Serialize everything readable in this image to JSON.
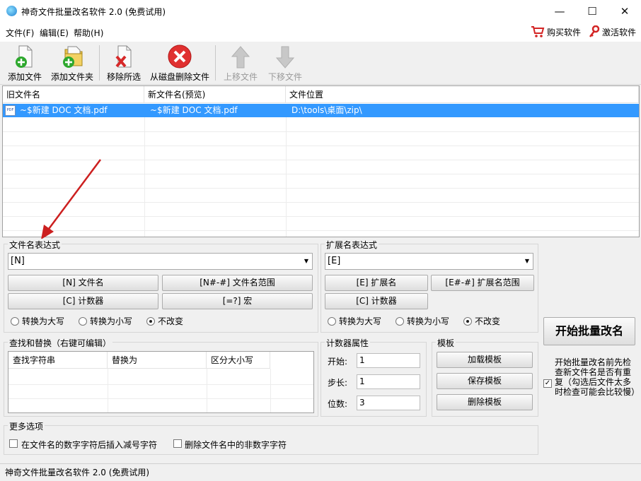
{
  "window": {
    "title": "神奇文件批量改名软件 2.0 (免费试用)",
    "minimize_glyph": "—",
    "maximize_glyph": "☐",
    "close_glyph": "✕"
  },
  "menu": {
    "items": [
      "文件(F)",
      "编辑(E)",
      "帮助(H)"
    ],
    "buy_label": "购买软件",
    "activate_label": "激活软件"
  },
  "toolbar": {
    "add_file": "添加文件",
    "add_folder": "添加文件夹",
    "remove_selected": "移除所选",
    "delete_from_disk": "从磁盘删除文件",
    "move_up": "上移文件",
    "move_down": "下移文件"
  },
  "file_list": {
    "columns": [
      "旧文件名",
      "新文件名(预览)",
      "文件位置"
    ],
    "rows": [
      {
        "old_name": "~$新建 DOC 文档.pdf",
        "new_name": "~$新建 DOC 文档.pdf",
        "location": "D:\\tools\\桌面\\zip\\"
      }
    ],
    "file_icon_text": "PDF"
  },
  "filename_expr": {
    "label": "文件名表达式",
    "value": "[N]",
    "buttons": [
      "[N] 文件名",
      "[N#-#] 文件名范围",
      "[C] 计数器",
      "[=?] 宏"
    ],
    "case_options": [
      "转换为大写",
      "转换为小写",
      "不改变"
    ],
    "case_selected": 2
  },
  "ext_expr": {
    "label": "扩展名表达式",
    "value": "[E]",
    "buttons": [
      "[E] 扩展名",
      "[E#-#] 扩展名范围",
      "[C] 计数器"
    ],
    "case_options": [
      "转换为大写",
      "转换为小写",
      "不改变"
    ],
    "case_selected": 2
  },
  "find_replace": {
    "label": "查找和替换（右键可编辑）",
    "columns": [
      "查找字符串",
      "替换为",
      "区分大小写"
    ]
  },
  "counter": {
    "label": "计数器属性",
    "start_label": "开始:",
    "start_value": "1",
    "step_label": "步长:",
    "step_value": "1",
    "digits_label": "位数:",
    "digits_value": "3"
  },
  "template": {
    "label": "模板",
    "load": "加载模板",
    "save": "保存模板",
    "delete": "删除模板"
  },
  "start": {
    "button": "开始批量改名",
    "check_text": "开始批量改名前先检查新文件名是否有重复（勾选后文件太多时检查可能会比较慢）",
    "checked": true
  },
  "more_options": {
    "label": "更多选项",
    "opt1": "在文件名的数字字符后插入减号字符",
    "opt2": "删除文件名中的非数字字符"
  },
  "status": {
    "text": "神奇文件批量改名软件 2.0 (免费试用)"
  },
  "colors": {
    "selection": "#3399ff",
    "delete_red": "#e03030",
    "add_green": "#2ea82e",
    "annotation_arrow": "#cc1f1f"
  }
}
